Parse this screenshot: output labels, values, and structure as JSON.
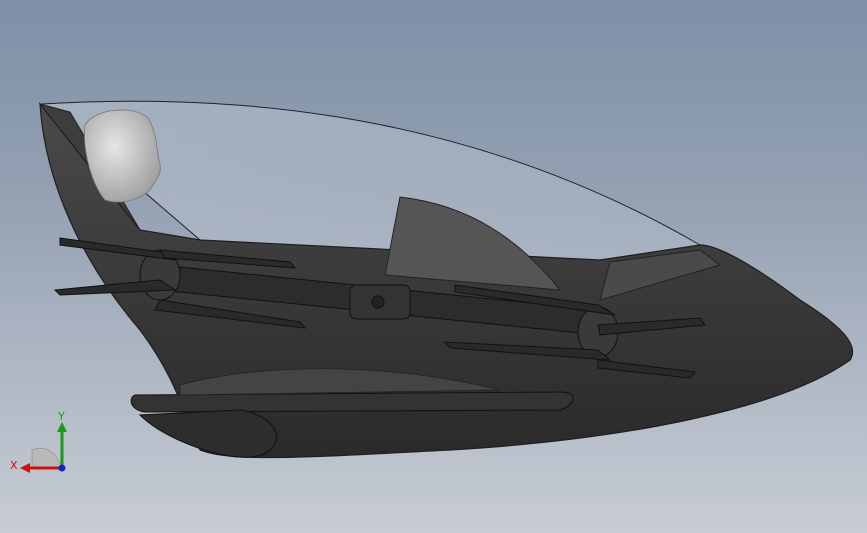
{
  "viewport": {
    "background_top": "#7f8fa6",
    "background_bottom": "#c7ccd4",
    "model_color": "#3c3c3c",
    "canopy_color": "#d8dde4"
  },
  "triad": {
    "x_label": "X",
    "y_label": "Y",
    "x_color": "#cc1111",
    "y_color": "#1a9a1a",
    "z_color": "#1122cc"
  }
}
